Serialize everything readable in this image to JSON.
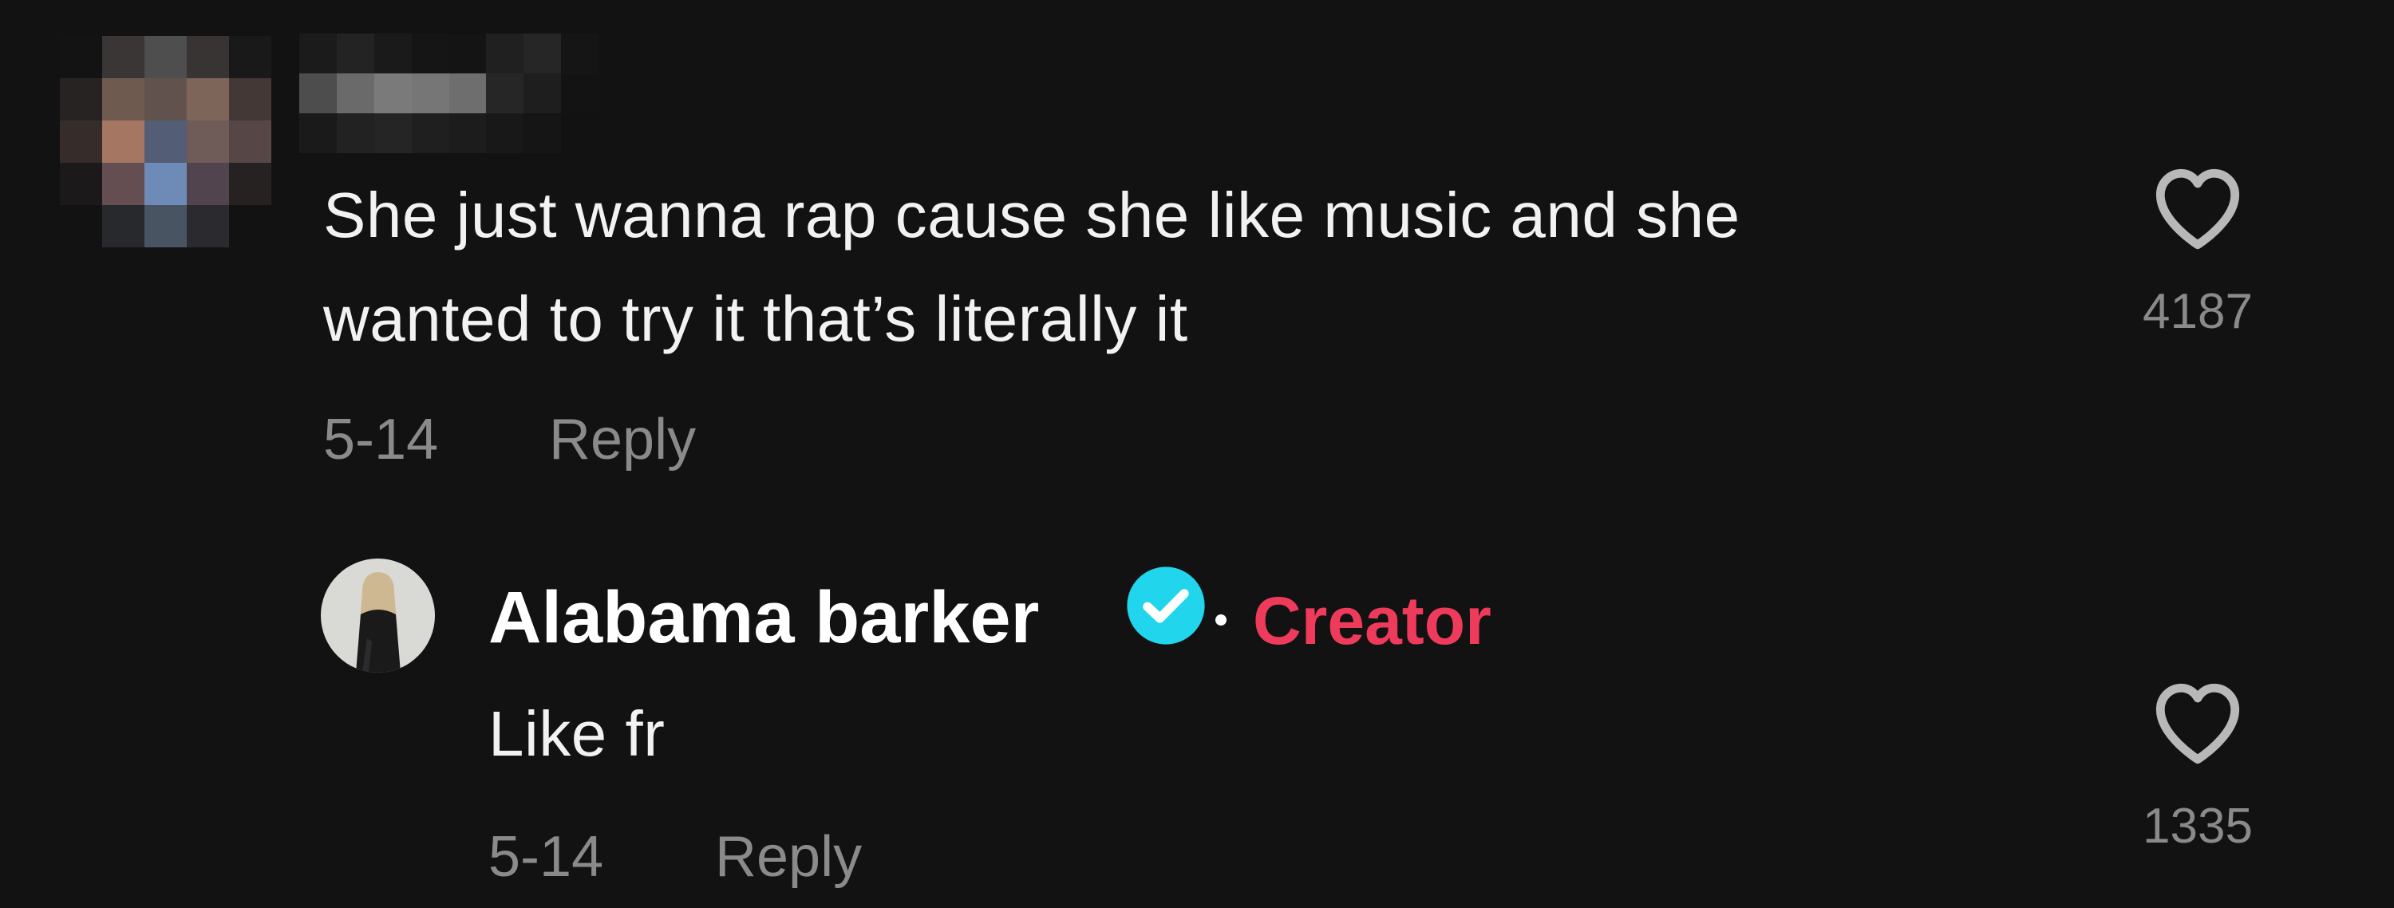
{
  "comment": {
    "text_line1": "She just wanna rap cause she like music and she",
    "text_line2": "wanted to try it that’s literally it",
    "date": "5-14",
    "reply_label": "Reply",
    "likes": "4187"
  },
  "reply": {
    "username": "Alabama barker",
    "badge": "Creator",
    "text": "Like fr",
    "date": "5-14",
    "reply_label": "Reply",
    "likes": "1335"
  },
  "colors": {
    "background": "#121212",
    "creator_badge": "#ee3b5c",
    "verified": "#20d5ec",
    "muted_text": "#8a8a8a"
  },
  "icons": {
    "like": "heart-outline-icon",
    "verified": "verified-check-icon"
  }
}
